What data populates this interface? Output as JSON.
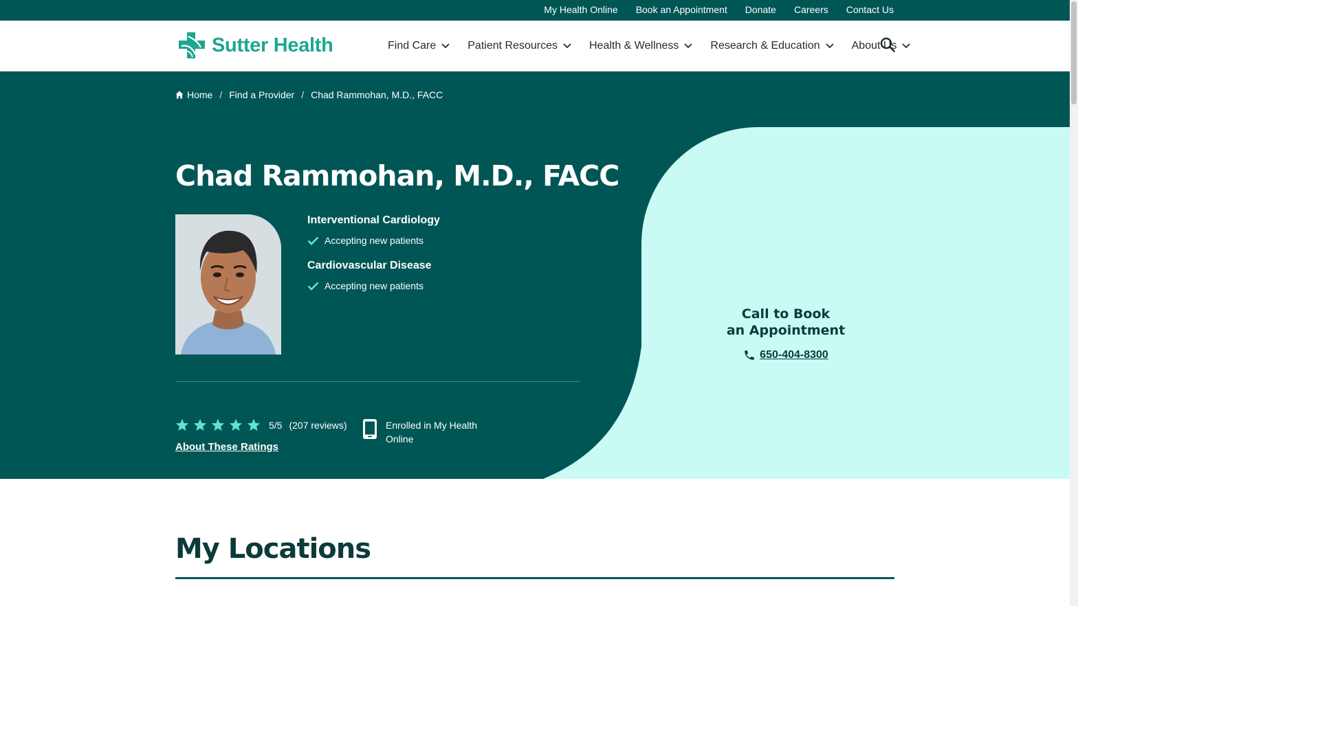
{
  "utility_nav": [
    "My Health Online",
    "Book an Appointment",
    "Donate",
    "Careers",
    "Contact Us"
  ],
  "logo": {
    "text": "Sutter Health",
    "color": "#1ea691"
  },
  "main_nav": [
    "Find Care",
    "Patient Resources",
    "Health & Wellness",
    "Research & Education",
    "About Us"
  ],
  "breadcrumb": [
    "Home",
    "Find a Provider",
    "Chad Rammohan, M.D., FACC"
  ],
  "provider": {
    "name": "Chad Rammohan, M.D., FACC",
    "specialties": [
      {
        "title": "Interventional Cardiology",
        "status": "Accepting new patients"
      },
      {
        "title": "Cardiovascular Disease",
        "status": "Accepting new patients"
      }
    ],
    "rating": {
      "score": "5/5",
      "reviews": "(207 reviews)",
      "stars": 5,
      "about_link": "About These Ratings"
    },
    "enrolled": "Enrolled in My Health Online"
  },
  "booking": {
    "title_line1": "Call to Book",
    "title_line2": "an Appointment",
    "phone": "650-404-8300"
  },
  "locations": {
    "title": "My Locations"
  },
  "colors": {
    "primary": "#005655",
    "panel": "#c9fbf4",
    "check": "#5ee5cf",
    "dark_text": "#0b3b3a"
  }
}
